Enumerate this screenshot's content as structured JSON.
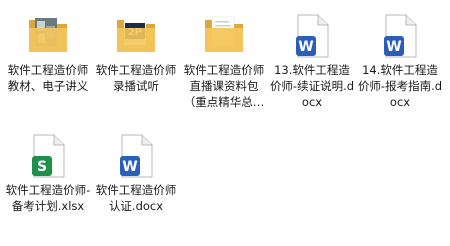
{
  "files": [
    {
      "name": "软件工程造价师教材、电子讲义",
      "type": "folder",
      "preview": "photo"
    },
    {
      "name": "软件工程造价师录播试听",
      "type": "folder",
      "preview": "logo"
    },
    {
      "name": "软件工程造价师直播课资料包（重点精华总…",
      "type": "folder",
      "preview": "papers"
    },
    {
      "name": "13.软件工程造价师-续证说明.docx",
      "type": "word",
      "badge": "W"
    },
    {
      "name": "14.软件工程造价师-报考指南.docx",
      "type": "word",
      "badge": "W"
    },
    {
      "name": "软件工程造价师-备考计划.xlsx",
      "type": "excel",
      "badge": "S"
    },
    {
      "name": "软件工程造价师认证.docx",
      "type": "word",
      "badge": "W"
    }
  ],
  "colors": {
    "folder": "#f3c65c",
    "folder_dark": "#dca640",
    "word": "#2b5eb8",
    "excel": "#1f8f4e"
  }
}
